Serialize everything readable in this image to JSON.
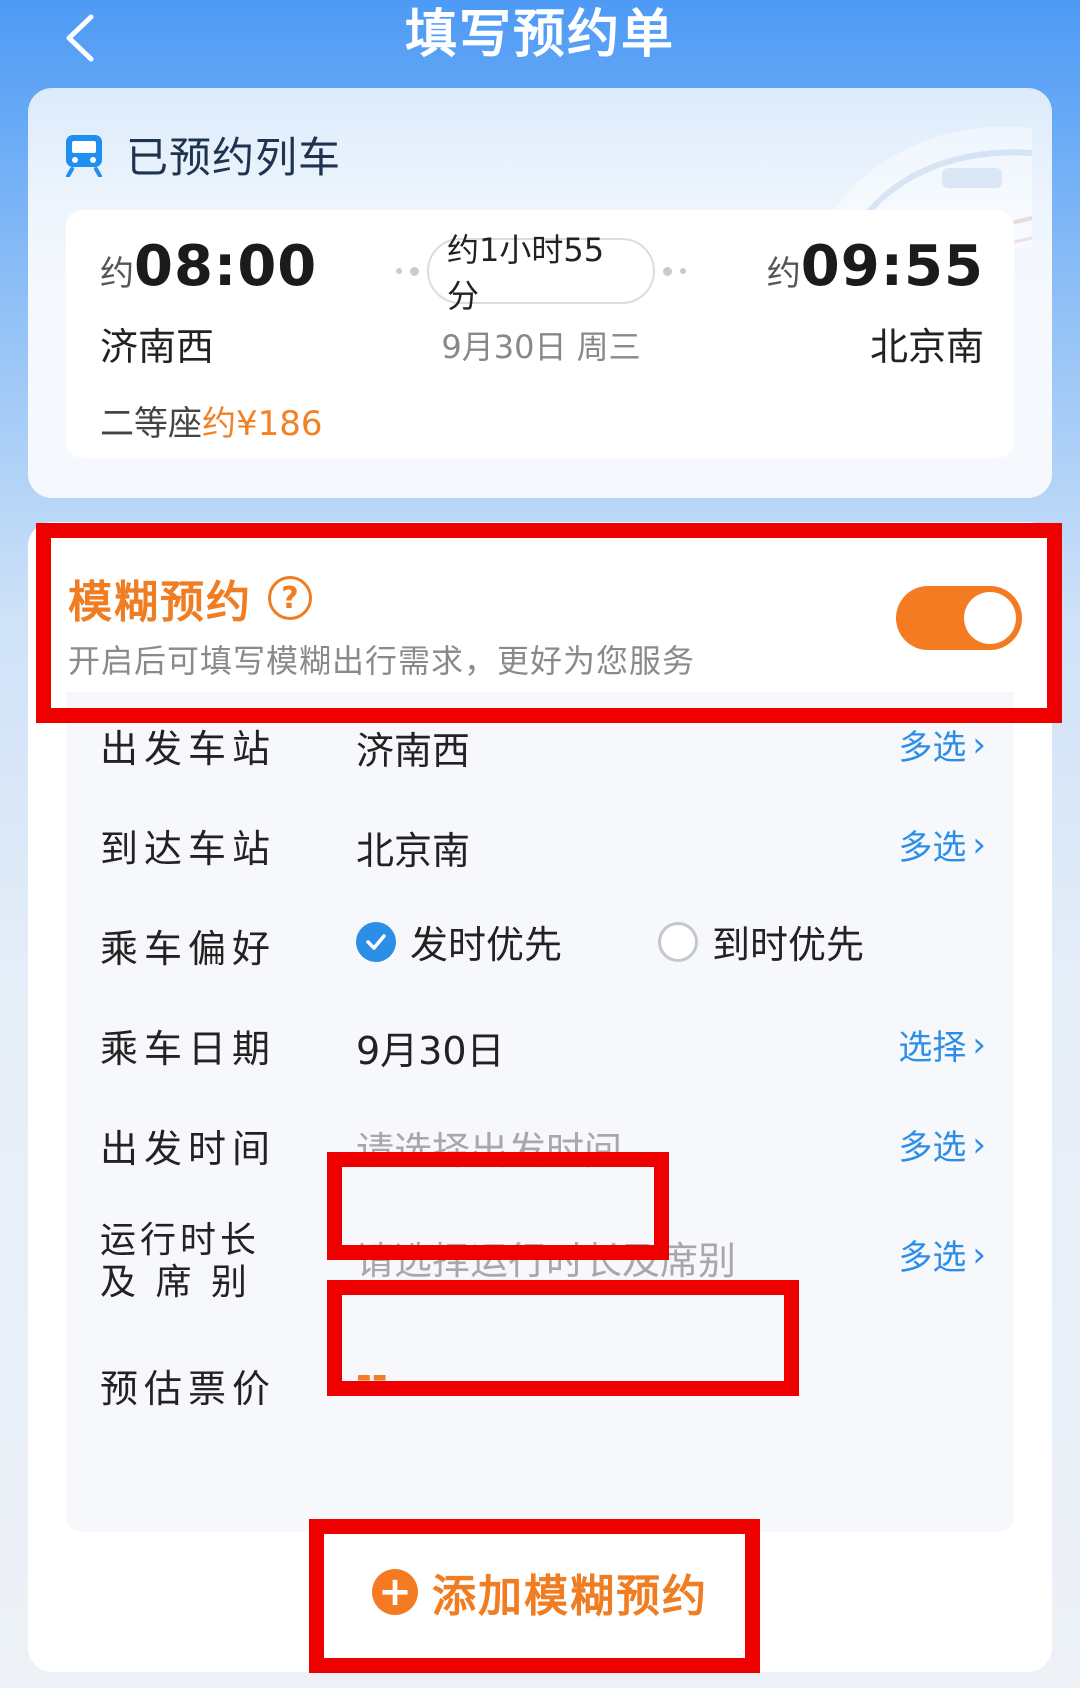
{
  "header": {
    "title": "填写预约单",
    "back_icon": "chevron-left-icon"
  },
  "train": {
    "section_title": "已预约列车",
    "icon": "train-icon",
    "depart_prefix": "约",
    "depart_time": "08:00",
    "depart_station": "济南西",
    "duration": "约1小时55分",
    "date": "9月30日 周三",
    "arrive_prefix": "约",
    "arrive_time": "09:55",
    "arrive_station": "北京南",
    "seat_class": "二等座",
    "price": "约¥186"
  },
  "fuzzy": {
    "title": "模糊预约",
    "help_icon": "question-circle-icon",
    "subtitle": "开启后可填写模糊出行需求，更好为您服务",
    "enabled": true,
    "accent_color": "#f47b22"
  },
  "form": {
    "departure_station": {
      "label": "出发车站",
      "value": "济南西",
      "action": "多选"
    },
    "arrival_station": {
      "label": "到达车站",
      "value": "北京南",
      "action": "多选"
    },
    "preference": {
      "label": "乘车偏好",
      "options": [
        {
          "label": "发时优先",
          "checked": true
        },
        {
          "label": "到时优先",
          "checked": false
        }
      ]
    },
    "date": {
      "label": "乘车日期",
      "value": "9月30日",
      "action": "选择"
    },
    "depart_time": {
      "label": "出发时间",
      "placeholder": "请选择出发时间",
      "action": "多选"
    },
    "duration_seat": {
      "label_line1": "运行时长",
      "label_line2": "及 席 别",
      "placeholder": "请选择运行时长及席别",
      "action": "多选"
    },
    "estimated_price": {
      "label": "预估票价",
      "value": "--"
    }
  },
  "add_button": {
    "label": "添加模糊预约",
    "icon": "plus-circle-icon"
  },
  "colors": {
    "primary_blue": "#2d8ee8",
    "orange": "#f07d22",
    "annotation_red": "#ee0000"
  }
}
